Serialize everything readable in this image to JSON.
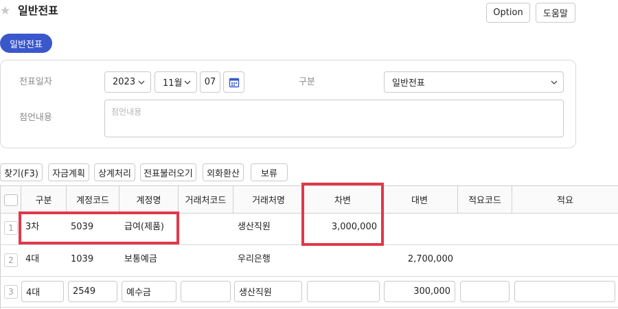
{
  "header": {
    "title": "일반전표",
    "option_label": "Option",
    "help_label": "도움말"
  },
  "tab": {
    "label": "일반전표"
  },
  "form": {
    "date_label": "전표일자",
    "year": "2023",
    "month": "11월",
    "day": "07",
    "type_label": "구분",
    "type_value": "일반전표",
    "attach_label": "첨언내용",
    "attach_placeholder": "첨언내용"
  },
  "actions": [
    "찾기(F3)",
    "자금계획",
    "상계처리",
    "전표불러오기",
    "외화환산",
    "보류"
  ],
  "grid": {
    "columns": [
      "구분",
      "계정코드",
      "계정명",
      "거래처코드",
      "거래처명",
      "차변",
      "대변",
      "적요코드",
      "적요"
    ],
    "rows": [
      {
        "no": "1",
        "gubun": "3차",
        "code": "5039",
        "name": "급여(제품)",
        "vendor_code": "",
        "vendor_name": "생산직원",
        "debit": "3,000,000",
        "credit": "",
        "memo_code": "",
        "memo": ""
      },
      {
        "no": "2",
        "gubun": "4대",
        "code": "1039",
        "name": "보통예금",
        "vendor_code": "",
        "vendor_name": "우리은행",
        "debit": "",
        "credit": "2,700,000",
        "memo_code": "",
        "memo": ""
      },
      {
        "no": "3",
        "gubun": "4대",
        "code": "2549",
        "name": "예수금",
        "vendor_code": "",
        "vendor_name": "생산직원",
        "debit": "",
        "credit": "300,000",
        "memo_code": "",
        "memo": ""
      }
    ]
  },
  "colors": {
    "accent": "#3a57cc",
    "highlight": "#e0384a"
  }
}
